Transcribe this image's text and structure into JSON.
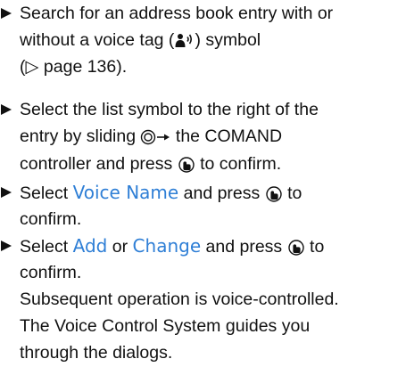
{
  "steps": [
    {
      "lines": [
        {
          "a": "Search for an address book entry with or"
        },
        {
          "a": "without a voice tag (",
          "b": ") symbol"
        },
        {
          "a": "(▷ page 136)."
        }
      ]
    },
    {
      "lines": [
        {
          "a": "Select the list symbol to the right of the"
        },
        {
          "a": "entry by sliding ",
          "b": " the COMAND"
        },
        {
          "a": "controller and press ",
          "b": " to confirm."
        }
      ]
    },
    {
      "lines": [
        {
          "a": "Select ",
          "hl": "Voice Name",
          "b": " and press ",
          "c": " to"
        },
        {
          "a": "confirm."
        }
      ]
    },
    {
      "lines": [
        {
          "a": "Select ",
          "hl1": "Add",
          "b": " or ",
          "hl2": "Change",
          "c": " and press ",
          "d": " to"
        },
        {
          "a": "confirm."
        },
        {
          "a": "Subsequent operation is voice-controlled."
        },
        {
          "a": "The Voice Control System guides you"
        },
        {
          "a": "through the dialogs."
        }
      ]
    }
  ],
  "icons": {
    "voice_tag": "voice-tag-icon",
    "slide_right": "controller-slide-right-icon",
    "press": "controller-press-icon"
  },
  "colors": {
    "text": "#111111",
    "highlight": "#2f7fd6",
    "background": "#ffffff"
  }
}
